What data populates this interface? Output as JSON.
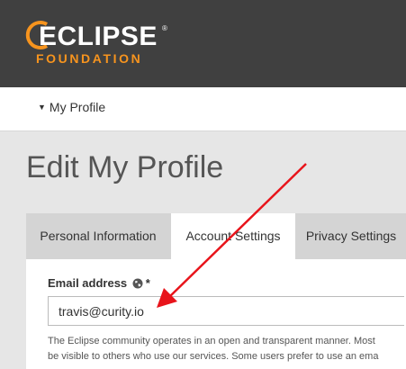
{
  "brand": {
    "name": "ECLIPSE",
    "registered": "®",
    "subtitle": "FOUNDATION",
    "accent_color": "#f7941e",
    "header_bg": "#404040"
  },
  "profile_menu": {
    "icon": "caret-down-icon",
    "label": "My Profile"
  },
  "page": {
    "title": "Edit My Profile"
  },
  "tabs": [
    {
      "label": "Personal Information",
      "active": false
    },
    {
      "label": "Account Settings",
      "active": true
    },
    {
      "label": "Privacy Settings",
      "active": false
    }
  ],
  "form": {
    "email_label": "Email address",
    "email_label_icon": "globe-icon",
    "required_marker": "*",
    "email_value": "travis@curity.io",
    "help_line1": "The Eclipse community operates in an open and transparent manner. Most",
    "help_line2": "be visible to others who use our services. Some users prefer to use an ema"
  },
  "annotation": {
    "type": "red-arrow",
    "color": "#e8141b"
  }
}
